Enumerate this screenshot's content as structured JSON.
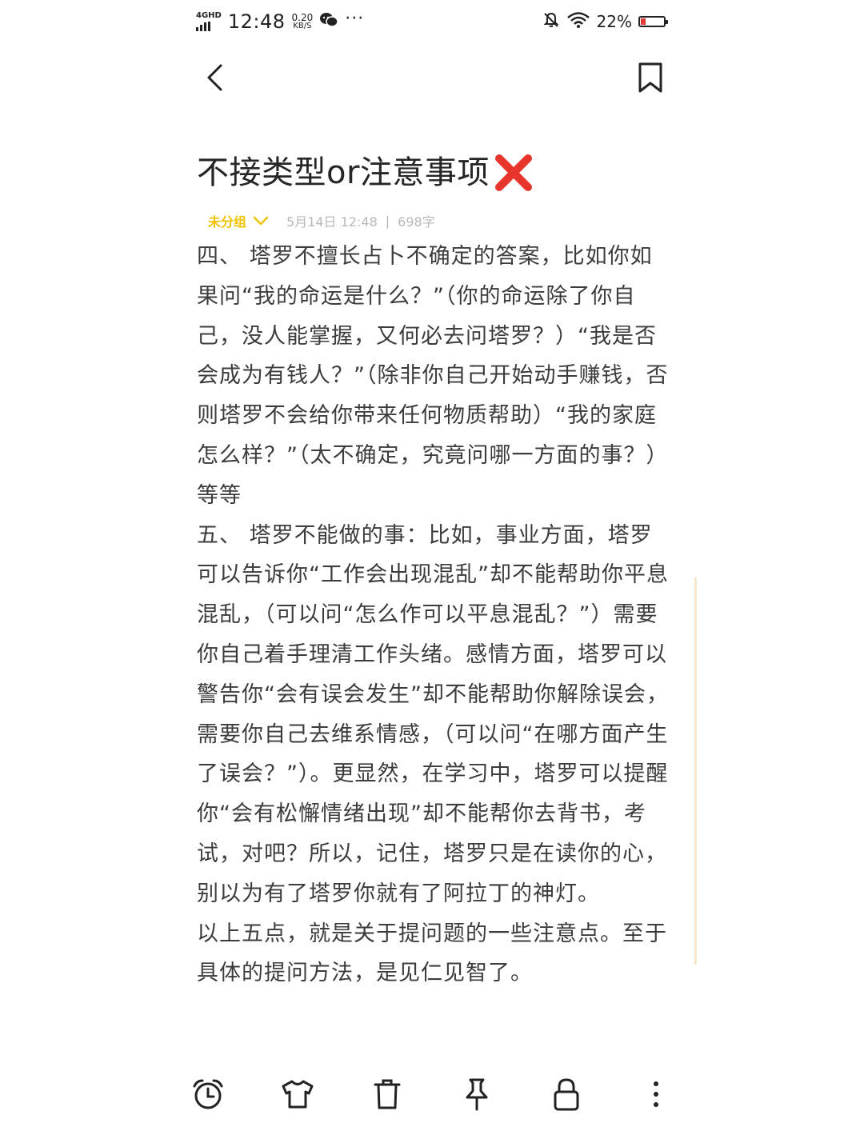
{
  "status_bar": {
    "network": "4GHD",
    "time": "12:48",
    "speed_value": "0.20",
    "speed_unit": "KB/S",
    "more": "···",
    "battery_percent": "22%",
    "battery_level": 0.22
  },
  "note": {
    "title": "不接类型or注意事项",
    "group_label": "未分组",
    "date": "5月14日 12:48",
    "separator": "|",
    "word_count": "698字",
    "paragraphs": [
      "四、 塔罗不擅长占卜不确定的答案，比如你如果问“我的命运是什么？”（你的命运除了你自己，没人能掌握，又何必去问塔罗？）“我是否会成为有钱人？”（除非你自己开始动手赚钱，否则塔罗不会给你带来任何物质帮助）“我的家庭怎么样？”（太不确定，究竟问哪一方面的事？）等等",
      "五、 塔罗不能做的事：比如，事业方面，塔罗可以告诉你“工作会出现混乱”却不能帮助你平息混乱，（可以问“怎么作可以平息混乱？”）需要你自己着手理清工作头绪。感情方面，塔罗可以警告你“会有误会发生”却不能帮助你解除误会，需要你自己去维系情感，（可以问“在哪方面产生了误会？”）。更显然，在学习中，塔罗可以提醒你“会有松懈情绪出现”却不能帮你去背书，考试，对吧？所以，记住，塔罗只是在读你的心，别以为有了塔罗你就有了阿拉丁的神灯。",
      "以上五点，就是关于提问题的一些注意点。至于具体的提问方法，是见仁见智了。"
    ]
  },
  "colors": {
    "accent": "#f2c200",
    "cross": "#e8352b",
    "meta_gray": "#b8b8b8",
    "text": "#3c3c3c"
  },
  "icons": {
    "back": "chevron-left-icon",
    "bookmark": "bookmark-icon",
    "title_emoji": "cross-mark-icon",
    "toolbar": [
      "alarm-clock-icon",
      "tshirt-icon",
      "trash-icon",
      "pin-icon",
      "lock-icon",
      "more-vertical-icon"
    ]
  }
}
